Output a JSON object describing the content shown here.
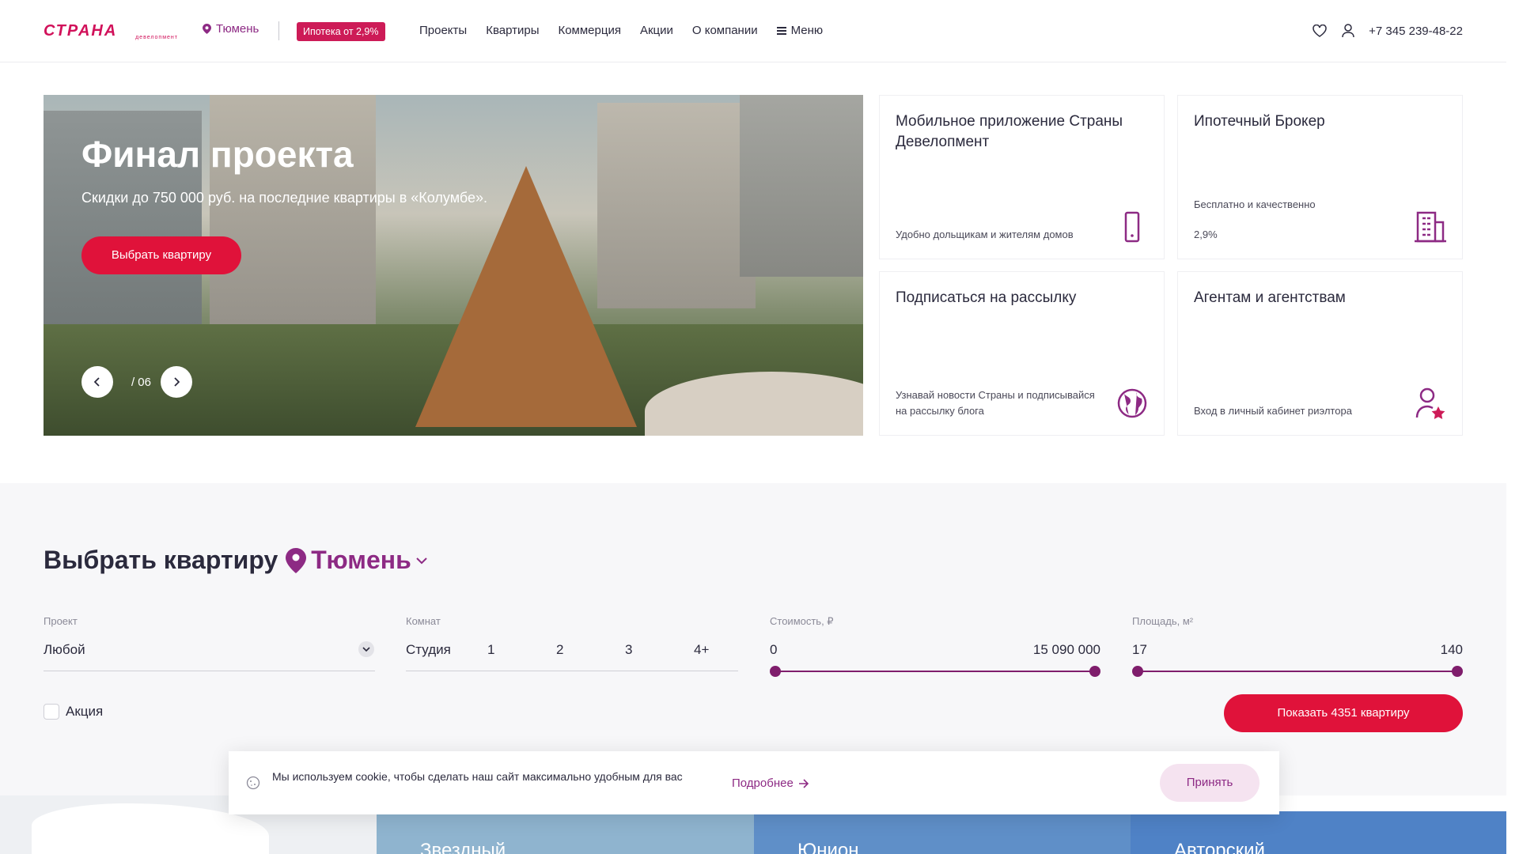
{
  "header": {
    "logo_text": "СТРАНА",
    "logo_sub": "девелопмент",
    "city": "Тюмень",
    "promo_badge": "Ипотека от 2,9%",
    "nav": [
      "Проекты",
      "Квартиры",
      "Коммерция",
      "Акции",
      "О компании"
    ],
    "menu_label": "Меню",
    "phone": "+7 345 239-48-22"
  },
  "hero": {
    "title": "Финал проекта",
    "subtitle": "Скидки до 750 000 руб. на последние квартиры в «Колумбе».",
    "button": "Выбрать квартиру",
    "counter_total": "/ 06"
  },
  "cards": [
    {
      "title": "Мобильное приложение Страны Девелопмент",
      "desc": "Удобно дольщикам и жителям домов",
      "icon": "phone-icon"
    },
    {
      "title": "Ипотечный Брокер",
      "desc_top": "Бесплатно и качественно",
      "desc": "2,9%",
      "icon": "building-icon"
    },
    {
      "title": "Подписаться на рассылку",
      "desc": "Узнавай новости Страны и подписывайся на рассылку блога",
      "icon": "globe-icon"
    },
    {
      "title": "Агентам и агентствам",
      "desc": "Вход в личный кабинет риэлтора",
      "icon": "agent-star-icon"
    }
  ],
  "selector": {
    "title": "Выбрать квартиру",
    "city": "Тюмень",
    "project_label": "Проект",
    "project_value": "Любой",
    "rooms_label": "Комнат",
    "rooms": [
      "Студия",
      "1",
      "2",
      "3",
      "4+"
    ],
    "price_label": "Стоимость, ₽",
    "price_min": "0",
    "price_max": "15 090 000",
    "area_label": "Площадь, м²",
    "area_min": "17",
    "area_max": "140",
    "promo_checkbox": "Акция",
    "show_button": "Показать 4351 квартиру"
  },
  "cookie": {
    "text": "Мы используем cookie, чтобы сделать наш сайт максимально удобным для вас",
    "more": "Подробнее",
    "accept": "Принять"
  },
  "projects": [
    {
      "name": "Звездный",
      "color": "#8fb4cf"
    },
    {
      "name": "Юнион",
      "color": "#5f8fc8"
    },
    {
      "name": "Авторский",
      "color": "#4f82c6"
    }
  ],
  "colors": {
    "accent": "#e0123a",
    "brand": "#8d2a84",
    "range": "#7f1d6c"
  }
}
